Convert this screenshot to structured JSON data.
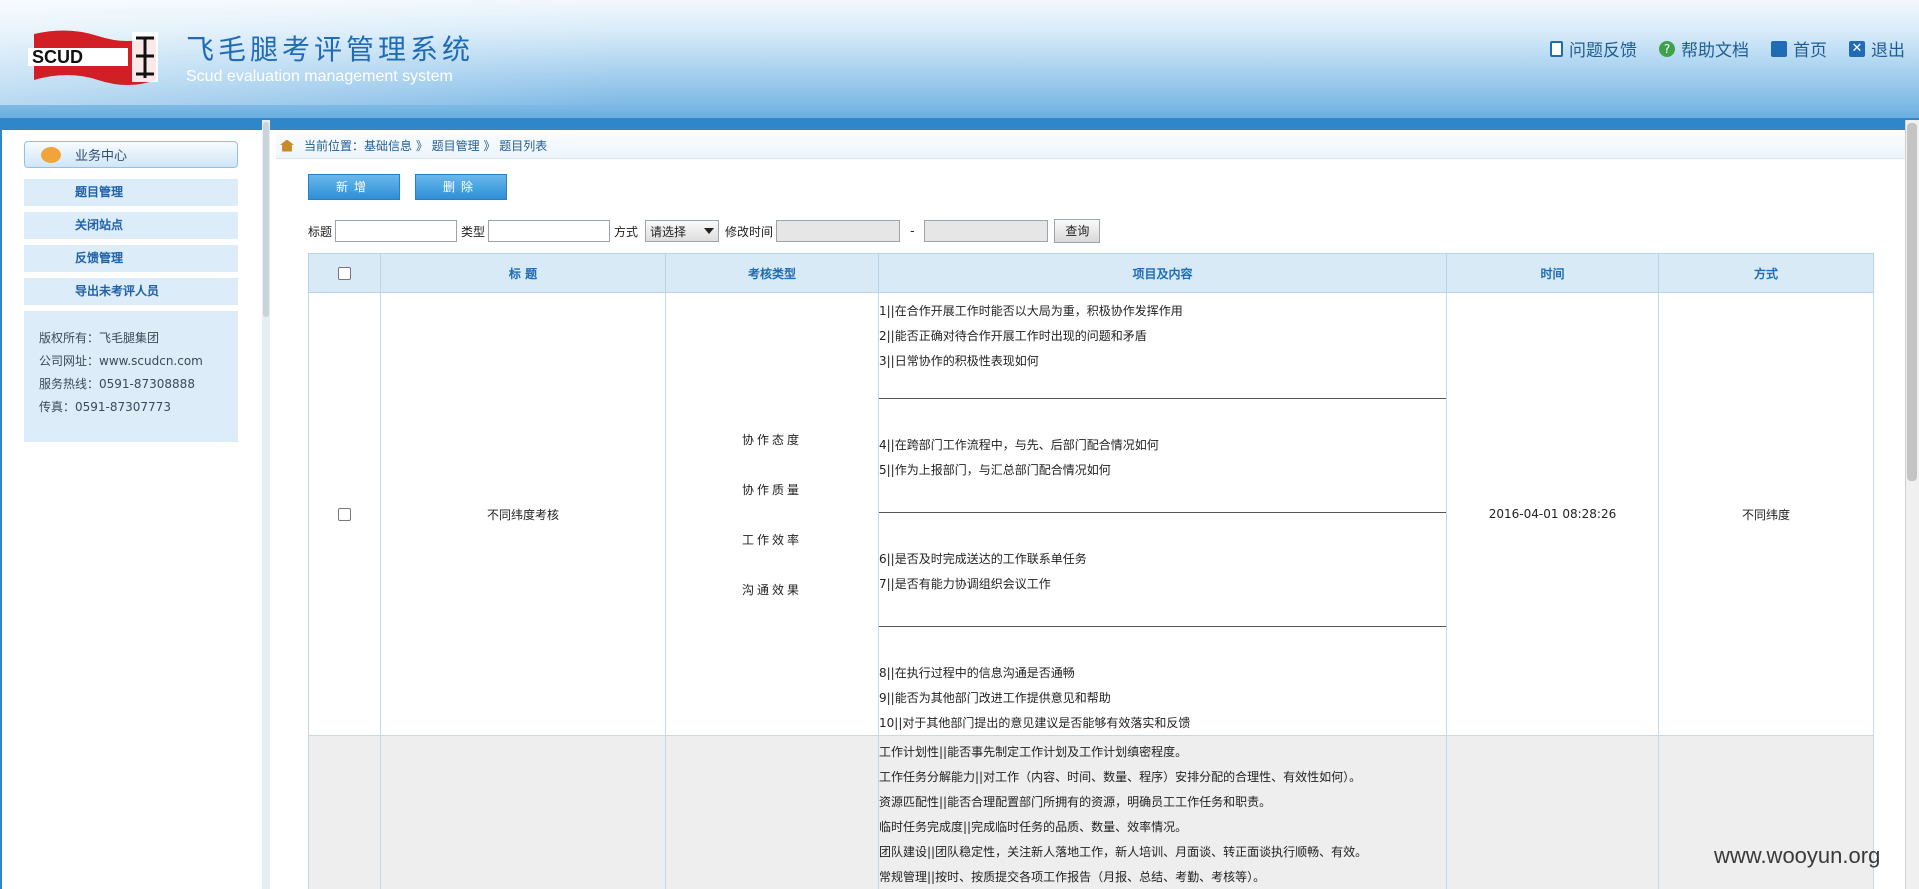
{
  "header": {
    "title_cn": "飞毛腿考评管理系统",
    "title_en": "Scud evaluation management system",
    "logo_text": "SCUD",
    "links": [
      {
        "label": "问题反馈",
        "icon": "document-icon"
      },
      {
        "label": "帮助文档",
        "icon": "help-icon"
      },
      {
        "label": "首页",
        "icon": "home-icon"
      },
      {
        "label": "退出",
        "icon": "close-icon"
      }
    ]
  },
  "sidebar": {
    "section_title": "业务中心",
    "items": [
      {
        "label": "题目管理"
      },
      {
        "label": "关闭站点"
      },
      {
        "label": "反馈管理"
      },
      {
        "label": "导出未考评人员"
      }
    ],
    "info": [
      "版权所有：飞毛腿集团",
      "公司网址：www.scudcn.com",
      "服务热线：0591-87308888",
      "传真：0591-87307773"
    ]
  },
  "breadcrumb": "当前位置：基础信息 》 题目管理 》 题目列表",
  "actions": {
    "add": "新增",
    "delete": "删除"
  },
  "filters": {
    "title_label": "标题",
    "type_label": "类型",
    "method_label": "方式",
    "method_value": "请选择",
    "modified_label": "修改时间",
    "range_sep": "-",
    "query": "查询"
  },
  "table": {
    "columns": [
      "标 题",
      "考核类型",
      "项目及内容",
      "时间",
      "方式"
    ],
    "rows": [
      {
        "title": "不同纬度考核",
        "types": [
          "协作态度",
          "协作质量",
          "工作效率",
          "沟通效果"
        ],
        "groups": [
          [
            "1||在合作开展工作时能否以大局为重，积极协作发挥作用",
            "2||能否正确对待合作开展工作时出现的问题和矛盾",
            "3||日常协作的积极性表现如何"
          ],
          [
            "4||在跨部门工作流程中，与先、后部门配合情况如何",
            "5||作为上报部门，与汇总部门配合情况如何"
          ],
          [
            "6||是否及时完成送达的工作联系单任务",
            "7||是否有能力协调组织会议工作"
          ],
          [
            "8||在执行过程中的信息沟通是否通畅",
            "9||能否为其他部门改进工作提供意见和帮助",
            "10||对于其他部门提出的意见建议是否能够有效落实和反馈"
          ]
        ],
        "time": "2016-04-01 08:28:26",
        "method": "不同纬度"
      },
      {
        "items": [
          "工作计划性||能否事先制定工作计划及工作计划缜密程度。",
          "工作任务分解能力||对工作（内容、时间、数量、程序）安排分配的合理性、有效性如何）。",
          "资源匹配性||能否合理配置部门所拥有的资源，明确员工工作任务和职责。",
          "临时任务完成度||完成临时任务的品质、数量、效率情况。",
          "团队建设||团队稳定性，关注新人落地工作，新人培训、月面谈、转正面谈执行顺畅、有效。",
          "常规管理||按时、按质提交各项工作报告（月报、总结、考勤、考核等）。"
        ]
      }
    ]
  },
  "watermark": "www.wooyun.org"
}
